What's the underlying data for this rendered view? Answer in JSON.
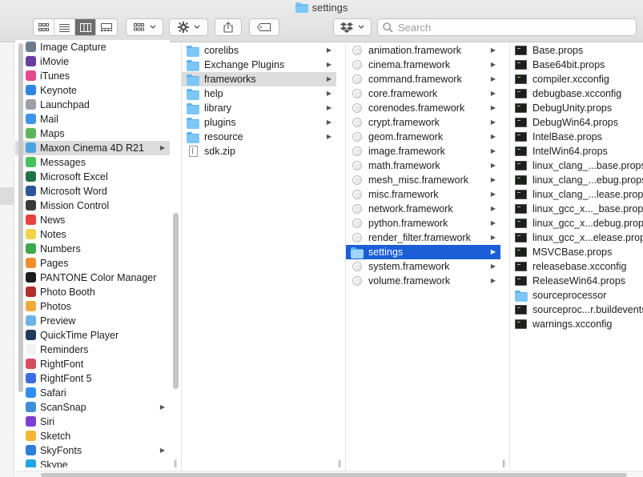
{
  "window": {
    "title": "settings"
  },
  "toolbar": {
    "search_placeholder": "Search",
    "view_modes": [
      "icon-view-icon",
      "list-view-icon",
      "column-view-icon",
      "gallery-view-icon"
    ],
    "active_view": 2
  },
  "colors": {
    "selection_blue": "#1b5ed6",
    "selection_grey": "#dcdcdc",
    "folder": "#7cc7f5"
  },
  "columns": {
    "apps": [
      {
        "label": "Image Capture",
        "color": "#6a7b8c"
      },
      {
        "label": "iMovie",
        "color": "#6b3fa0"
      },
      {
        "label": "iTunes",
        "color": "#e44a8d"
      },
      {
        "label": "Keynote",
        "color": "#2f86e0"
      },
      {
        "label": "Launchpad",
        "color": "#9aa0a8"
      },
      {
        "label": "Mail",
        "color": "#3f95e8"
      },
      {
        "label": "Maps",
        "color": "#5bb55b"
      },
      {
        "label": "Maxon Cinema 4D R21",
        "color": "#4aa3df",
        "selected": true,
        "arrow": true
      },
      {
        "label": "Messages",
        "color": "#48c25a"
      },
      {
        "label": "Microsoft Excel",
        "color": "#1e7245"
      },
      {
        "label": "Microsoft Word",
        "color": "#2b579a"
      },
      {
        "label": "Mission Control",
        "color": "#3a3a3a"
      },
      {
        "label": "News",
        "color": "#e8423c"
      },
      {
        "label": "Notes",
        "color": "#f1d34a"
      },
      {
        "label": "Numbers",
        "color": "#3aa84b"
      },
      {
        "label": "Pages",
        "color": "#f28f2c"
      },
      {
        "label": "PANTONE Color Manager",
        "color": "#1d1d1d"
      },
      {
        "label": "Photo Booth",
        "color": "#b32d2d"
      },
      {
        "label": "Photos",
        "color": "#f2a93b"
      },
      {
        "label": "Preview",
        "color": "#6cb2e8"
      },
      {
        "label": "QuickTime Player",
        "color": "#223a5e"
      },
      {
        "label": "Reminders",
        "color": "#f2f2f2"
      },
      {
        "label": "RightFont",
        "color": "#d94e5e"
      },
      {
        "label": "RightFont 5",
        "color": "#3c6de0"
      },
      {
        "label": "Safari",
        "color": "#2f8ef0"
      },
      {
        "label": "ScanSnap",
        "color": "#3e8ed8",
        "arrow": true
      },
      {
        "label": "Siri",
        "color": "#7d3fd3"
      },
      {
        "label": "Sketch",
        "color": "#f3b735"
      },
      {
        "label": "SkyFonts",
        "color": "#2d7ed8",
        "arrow": true
      },
      {
        "label": "Skype",
        "color": "#1fa6e6"
      }
    ],
    "c4d": [
      {
        "label": "corelibs",
        "arrow": true
      },
      {
        "label": "Exchange Plugins",
        "arrow": true
      },
      {
        "label": "frameworks",
        "arrow": true,
        "selected": true
      },
      {
        "label": "help",
        "arrow": true
      },
      {
        "label": "library",
        "arrow": true
      },
      {
        "label": "plugins",
        "arrow": true
      },
      {
        "label": "resource",
        "arrow": true
      },
      {
        "label": "sdk.zip",
        "file": true
      }
    ],
    "frameworks": [
      {
        "label": "animation.framework",
        "arrow": true
      },
      {
        "label": "cinema.framework",
        "arrow": true
      },
      {
        "label": "command.framework",
        "arrow": true
      },
      {
        "label": "core.framework",
        "arrow": true
      },
      {
        "label": "corenodes.framework",
        "arrow": true
      },
      {
        "label": "crypt.framework",
        "arrow": true
      },
      {
        "label": "geom.framework",
        "arrow": true
      },
      {
        "label": "image.framework",
        "arrow": true
      },
      {
        "label": "math.framework",
        "arrow": true
      },
      {
        "label": "mesh_misc.framework",
        "arrow": true
      },
      {
        "label": "misc.framework",
        "arrow": true
      },
      {
        "label": "network.framework",
        "arrow": true
      },
      {
        "label": "python.framework",
        "arrow": true
      },
      {
        "label": "render_filter.framework",
        "arrow": true
      },
      {
        "label": "settings",
        "arrow": true,
        "selected": true,
        "folder": true
      },
      {
        "label": "system.framework",
        "arrow": true
      },
      {
        "label": "volume.framework",
        "arrow": true
      }
    ],
    "settings": [
      {
        "label": "Base.props"
      },
      {
        "label": "Base64bit.props"
      },
      {
        "label": "compiler.xcconfig"
      },
      {
        "label": "debugbase.xcconfig"
      },
      {
        "label": "DebugUnity.props"
      },
      {
        "label": "DebugWin64.props"
      },
      {
        "label": "IntelBase.props"
      },
      {
        "label": "IntelWin64.props"
      },
      {
        "label": "linux_clang_...base.props"
      },
      {
        "label": "linux_clang_...ebug.props"
      },
      {
        "label": "linux_clang_...lease.props"
      },
      {
        "label": "linux_gcc_x..._base.props"
      },
      {
        "label": "linux_gcc_x...debug.props"
      },
      {
        "label": "linux_gcc_x...elease.props"
      },
      {
        "label": "MSVCBase.props"
      },
      {
        "label": "releasebase.xcconfig"
      },
      {
        "label": "ReleaseWin64.props"
      },
      {
        "label": "sourceprocessor",
        "folder": true
      },
      {
        "label": "sourceproc...r.buildevents"
      },
      {
        "label": "warnings.xcconfig"
      }
    ]
  }
}
